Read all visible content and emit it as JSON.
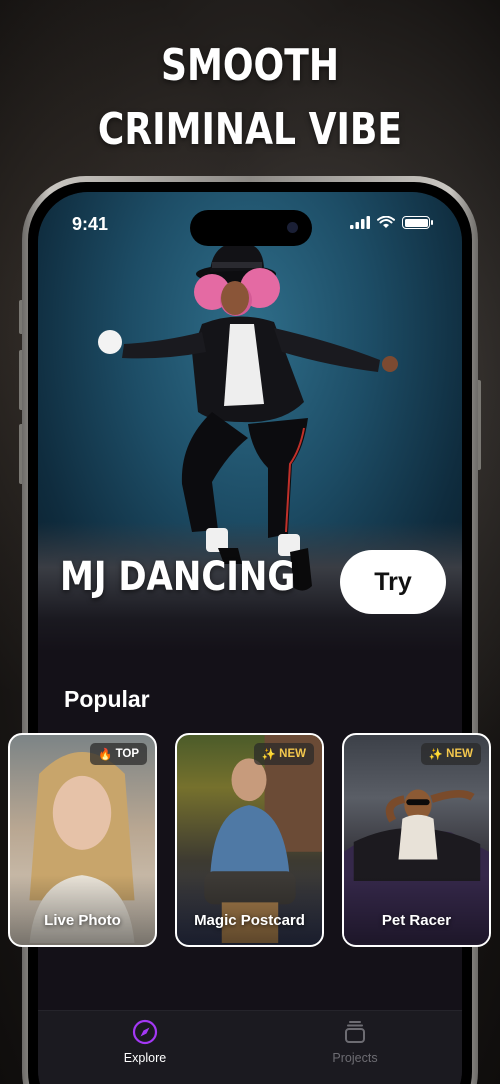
{
  "headline": {
    "line1": "SMOOTH",
    "line2": "CRIMINAL VIBE"
  },
  "status_bar": {
    "time": "9:41"
  },
  "hero": {
    "title": "MJ DANCING",
    "try_label": "Try"
  },
  "popular": {
    "title": "Popular",
    "cards": [
      {
        "label": "Live Photo",
        "badge": "TOP",
        "badge_icon": "fire-icon"
      },
      {
        "label": "Magic Postcard",
        "badge": "NEW",
        "badge_icon": "sparkle-icon"
      },
      {
        "label": "Pet Racer",
        "badge": "NEW",
        "badge_icon": "sparkle-icon"
      }
    ]
  },
  "tabbar": {
    "tabs": [
      {
        "label": "Explore",
        "icon": "compass-icon",
        "active": true
      },
      {
        "label": "Projects",
        "icon": "stack-icon",
        "active": false
      }
    ]
  },
  "colors": {
    "accent": "#a438f5",
    "badge_new": "#f3c74d",
    "inactive_tab": "#6d6c72"
  }
}
